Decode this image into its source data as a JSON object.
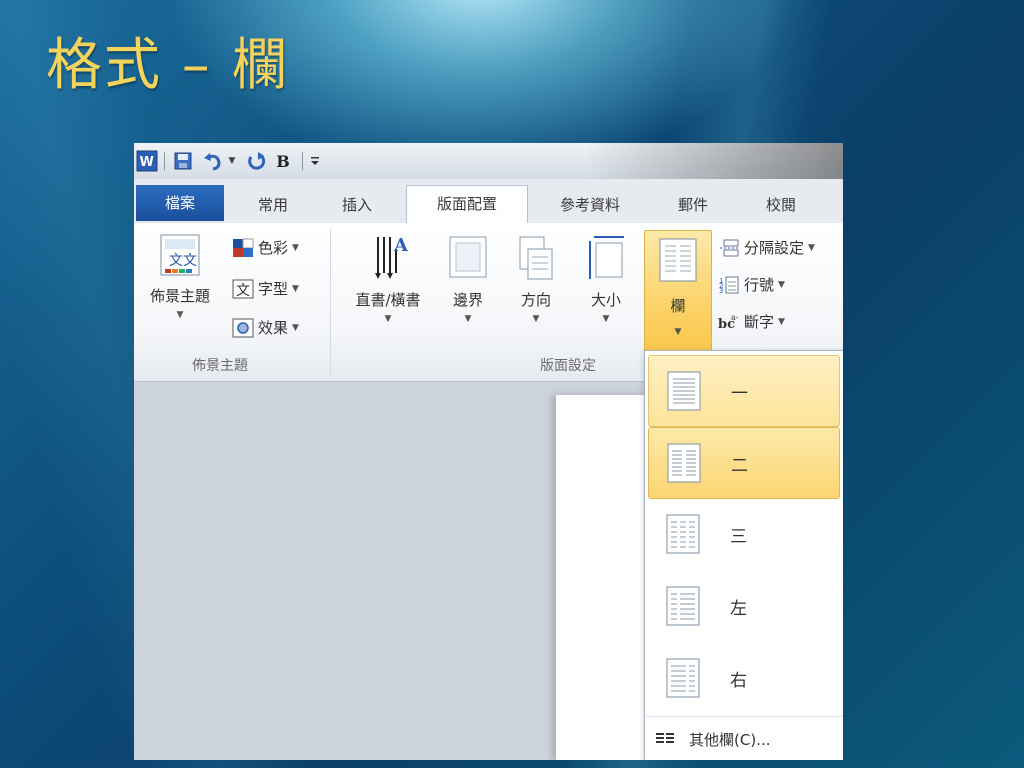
{
  "slide": {
    "title": "格式 – 欄"
  },
  "qat": {
    "bold": "B"
  },
  "tabs": [
    "檔案",
    "常用",
    "插入",
    "版面配置",
    "參考資料",
    "郵件",
    "校閱"
  ],
  "ribbon": {
    "theme_group": {
      "label": "佈景主題",
      "themes": "佈景主題",
      "colors": "色彩",
      "fonts": "字型",
      "effects": "效果"
    },
    "page_setup_group": {
      "label": "版面設定",
      "orientation_text": "直書/橫書",
      "margins": "邊界",
      "direction": "方向",
      "size": "大小",
      "columns": "欄",
      "breaks": "分隔設定",
      "line_numbers": "行號",
      "hyphenation": "斷字"
    }
  },
  "columns_menu": {
    "items": [
      "一",
      "二",
      "三",
      "左",
      "右"
    ],
    "more": "其他欄(C)..."
  },
  "colors": {
    "accent": "#f4d35a",
    "highlight": "#fbd572",
    "file_tab": "#1f5aa8"
  }
}
